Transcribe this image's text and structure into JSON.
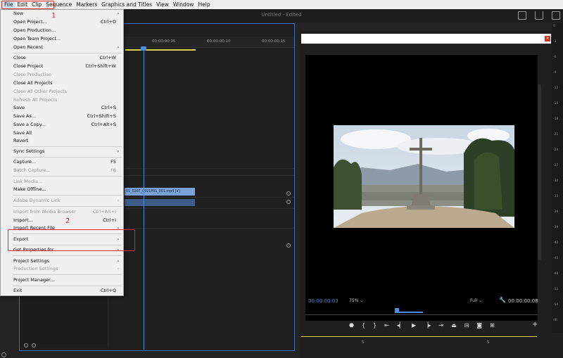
{
  "menubar": {
    "items": [
      {
        "label": "File"
      },
      {
        "label": "Edit"
      },
      {
        "label": "Clip"
      },
      {
        "label": "Sequence"
      },
      {
        "label": "Markers"
      },
      {
        "label": "Graphics and Titles"
      },
      {
        "label": "View"
      },
      {
        "label": "Window"
      },
      {
        "label": "Help"
      }
    ]
  },
  "titlebar": {
    "title": "Untitled - Edited"
  },
  "timeline": {
    "timecodes": [
      "00:00:00:05",
      "00:00:00:10",
      "00:00:00:15"
    ],
    "clip_label": "01_0207_0921P01_001.mp4 [V]"
  },
  "program": {
    "current_timecode": "00:00:00:03",
    "duration_timecode": "00:00:00:08",
    "zoom": "75%",
    "quality": "Full",
    "marker_s": "S"
  },
  "meters": {
    "labels": [
      "0",
      "-3",
      "-6",
      "-9",
      "-12",
      "-15",
      "-18",
      "-21",
      "-24",
      "-27",
      "-30",
      "-33",
      "-36",
      "-39",
      "-42",
      "-45",
      "-48",
      "-51",
      "-54",
      "dB"
    ]
  },
  "file_menu": {
    "items": [
      {
        "label": "New",
        "shortcut": "",
        "submenu": true,
        "disabled": false
      },
      {
        "label": "Open Project...",
        "shortcut": "Ctrl+O",
        "submenu": false,
        "disabled": false
      },
      {
        "label": "Open Production...",
        "shortcut": "",
        "submenu": false,
        "disabled": false
      },
      {
        "label": "Open Team Project...",
        "shortcut": "",
        "submenu": false,
        "disabled": false
      },
      {
        "label": "Open Recent",
        "shortcut": "",
        "submenu": true,
        "disabled": false
      },
      {
        "label": "Close",
        "shortcut": "Ctrl+W",
        "submenu": false,
        "disabled": false
      },
      {
        "label": "Close Project",
        "shortcut": "Ctrl+Shift+W",
        "submenu": false,
        "disabled": false
      },
      {
        "label": "Close Production",
        "shortcut": "",
        "submenu": false,
        "disabled": true
      },
      {
        "label": "Close All Projects",
        "shortcut": "",
        "submenu": false,
        "disabled": false
      },
      {
        "label": "Close All Other Projects",
        "shortcut": "",
        "submenu": false,
        "disabled": true
      },
      {
        "label": "Refresh All Projects",
        "shortcut": "",
        "submenu": false,
        "disabled": true
      },
      {
        "label": "Save",
        "shortcut": "Ctrl+S",
        "submenu": false,
        "disabled": false
      },
      {
        "label": "Save As...",
        "shortcut": "Ctrl+Shift+S",
        "submenu": false,
        "disabled": false
      },
      {
        "label": "Save a Copy...",
        "shortcut": "Ctrl+Alt+S",
        "submenu": false,
        "disabled": false
      },
      {
        "label": "Save All",
        "shortcut": "",
        "submenu": false,
        "disabled": false
      },
      {
        "label": "Revert",
        "shortcut": "",
        "submenu": false,
        "disabled": false
      },
      {
        "label": "Sync Settings",
        "shortcut": "",
        "submenu": true,
        "disabled": false
      },
      {
        "label": "Capture...",
        "shortcut": "F5",
        "submenu": false,
        "disabled": false
      },
      {
        "label": "Batch Capture...",
        "shortcut": "F6",
        "submenu": false,
        "disabled": true
      },
      {
        "label": "Link Media...",
        "shortcut": "",
        "submenu": false,
        "disabled": true
      },
      {
        "label": "Make Offline...",
        "shortcut": "",
        "submenu": false,
        "disabled": false
      },
      {
        "label": "Adobe Dynamic Link",
        "shortcut": "",
        "submenu": true,
        "disabled": true
      },
      {
        "label": "Import from Media Browser",
        "shortcut": "Ctrl+Alt+I",
        "submenu": false,
        "disabled": true
      },
      {
        "label": "Import...",
        "shortcut": "Ctrl+I",
        "submenu": false,
        "disabled": false
      },
      {
        "label": "Import Recent File",
        "shortcut": "",
        "submenu": true,
        "disabled": false
      },
      {
        "label": "Export",
        "shortcut": "",
        "submenu": true,
        "disabled": false
      },
      {
        "label": "Get Properties for",
        "shortcut": "",
        "submenu": true,
        "disabled": false
      },
      {
        "label": "Project Settings",
        "shortcut": "",
        "submenu": true,
        "disabled": false
      },
      {
        "label": "Production Settings",
        "shortcut": "",
        "submenu": true,
        "disabled": true
      },
      {
        "label": "Project Manager...",
        "shortcut": "",
        "submenu": false,
        "disabled": false
      },
      {
        "label": "Exit",
        "shortcut": "Ctrl+Q",
        "submenu": false,
        "disabled": false
      }
    ]
  },
  "annotations": {
    "step1": "1",
    "step2": "2"
  }
}
